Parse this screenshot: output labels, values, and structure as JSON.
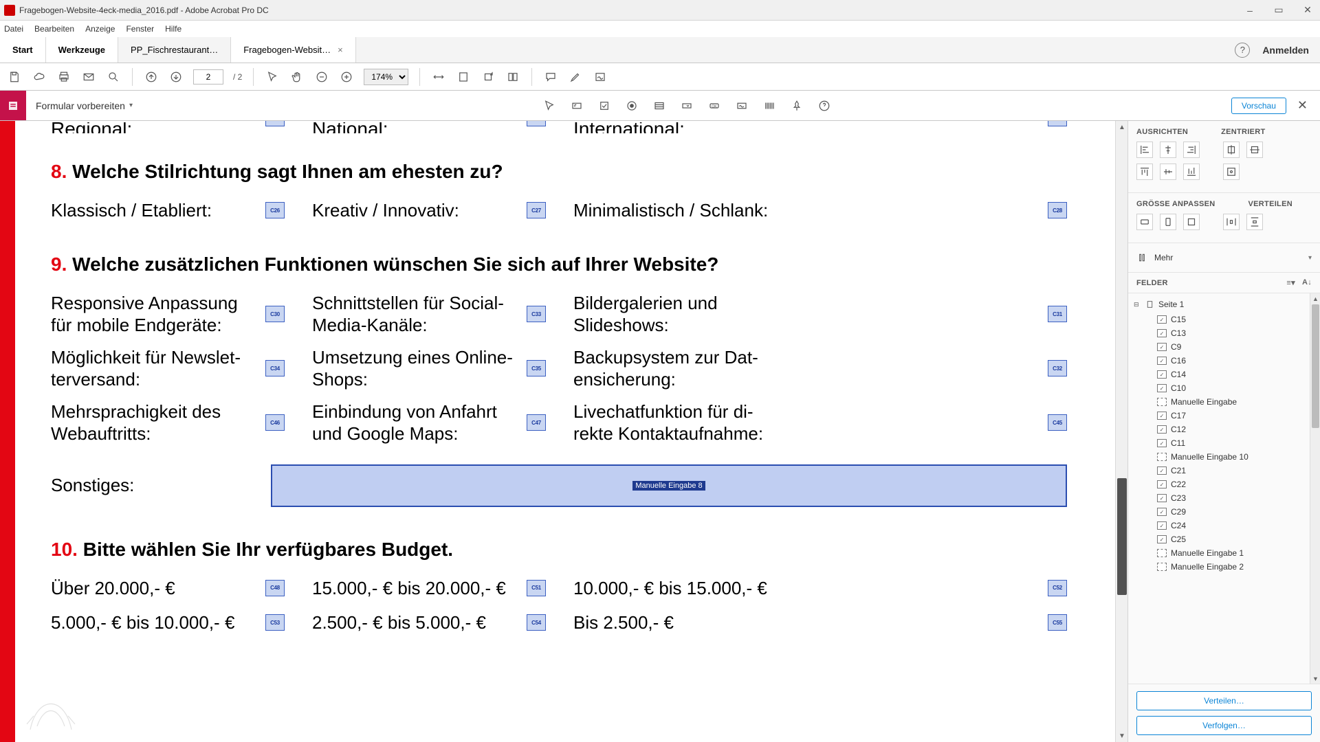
{
  "window": {
    "title": "Fragebogen-Website-4eck-media_2016.pdf - Adobe Acrobat Pro DC",
    "minimize": "–",
    "maximize": "▭",
    "close": "✕"
  },
  "menu": {
    "datei": "Datei",
    "bearbeiten": "Bearbeiten",
    "anzeige": "Anzeige",
    "fenster": "Fenster",
    "hilfe": "Hilfe"
  },
  "tabs": {
    "start": "Start",
    "werkzeuge": "Werkzeuge",
    "tab1": "PP_Fischrestaurant…",
    "tab2": "Fragebogen-Websit…",
    "help_icon": "?",
    "login": "Anmelden"
  },
  "toolbar1": {
    "page_current": "2",
    "page_total": "/ 2",
    "zoom": "174%"
  },
  "toolbar2": {
    "mode": "Formular vorbereiten",
    "vorschau": "Vorschau",
    "close": "✕"
  },
  "doc": {
    "cut": {
      "regional": "Regional:",
      "national": "National:",
      "international": "International:"
    },
    "q8": {
      "num": "8.",
      "title": "Welche Stilrichtung sagt Ihnen am ehesten zu?",
      "a1": "Klassisch / Etabliert:",
      "f1": "C26",
      "a2": "Kreativ / Innovativ:",
      "f2": "C27",
      "a3": "Minimalistisch / Schlank:",
      "f3": "C28"
    },
    "q9": {
      "num": "9.",
      "title": "Welche zusätzlichen Funktionen wünschen Sie sich auf Ihrer Website?",
      "r1a": "Responsive Anpassung für mobile Endgeräte:",
      "r1af": "C30",
      "r1b": "Schnittstellen für Social-Media-Kanäle:",
      "r1bf": "C33",
      "r1c": "Bildergalerien und Slideshows:",
      "r1cf": "C31",
      "r2a": "Möglichkeit für Newslet-terversand:",
      "r2af": "C34",
      "r2b": "Umsetzung eines Online-Shops:",
      "r2bf": "C35",
      "r2c": "Backupsystem zur Dat-ensicherung:",
      "r2cf": "C32",
      "r3a": "Mehrsprachigkeit des Webauftritts:",
      "r3af": "C46",
      "r3b": "Einbindung von Anfahrt und Google Maps:",
      "r3bf": "C47",
      "r3c": "Livechatfunktion für di-rekte Kontaktaufnahme:",
      "r3cf": "C45",
      "sonstiges": "Sonstiges:",
      "sonstiges_field": "Manuelle Eingabe 8"
    },
    "q10": {
      "num": "10.",
      "title": "Bitte wählen Sie Ihr verfügbares Budget.",
      "a1": "Über 20.000,- €",
      "f1": "C48",
      "a2": "15.000,- € bis 20.000,- €",
      "f2": "C51",
      "a3": "10.000,- € bis 15.000,- €",
      "f3": "C52",
      "b1": "5.000,- € bis 10.000,- €",
      "g1": "C53",
      "b2": "2.500,- € bis 5.000,- €",
      "g2": "C54",
      "b3": "Bis 2.500,- €",
      "g3": "C55"
    }
  },
  "panel": {
    "ausrichten": "AUSRICHTEN",
    "zentriert": "ZENTRIERT",
    "groesse": "GRÖSSE ANPASSEN",
    "verteilen": "VERTEILEN",
    "mehr": "Mehr",
    "felder": "FELDER",
    "page_root": "Seite 1",
    "fields": [
      {
        "t": "chk",
        "n": "C15"
      },
      {
        "t": "chk",
        "n": "C13"
      },
      {
        "t": "chk",
        "n": "C9"
      },
      {
        "t": "chk",
        "n": "C16"
      },
      {
        "t": "chk",
        "n": "C14"
      },
      {
        "t": "chk",
        "n": "C10"
      },
      {
        "t": "txt",
        "n": "Manuelle Eingabe"
      },
      {
        "t": "chk",
        "n": "C17"
      },
      {
        "t": "chk",
        "n": "C12"
      },
      {
        "t": "chk",
        "n": "C11"
      },
      {
        "t": "txt",
        "n": "Manuelle Eingabe 10"
      },
      {
        "t": "chk",
        "n": "C21"
      },
      {
        "t": "chk",
        "n": "C22"
      },
      {
        "t": "chk",
        "n": "C23"
      },
      {
        "t": "chk",
        "n": "C29"
      },
      {
        "t": "chk",
        "n": "C24"
      },
      {
        "t": "chk",
        "n": "C25"
      },
      {
        "t": "txt",
        "n": "Manuelle Eingabe 1"
      },
      {
        "t": "txt",
        "n": "Manuelle Eingabe 2"
      }
    ],
    "verteilen_btn": "Verteilen…",
    "verfolgen_btn": "Verfolgen…"
  }
}
